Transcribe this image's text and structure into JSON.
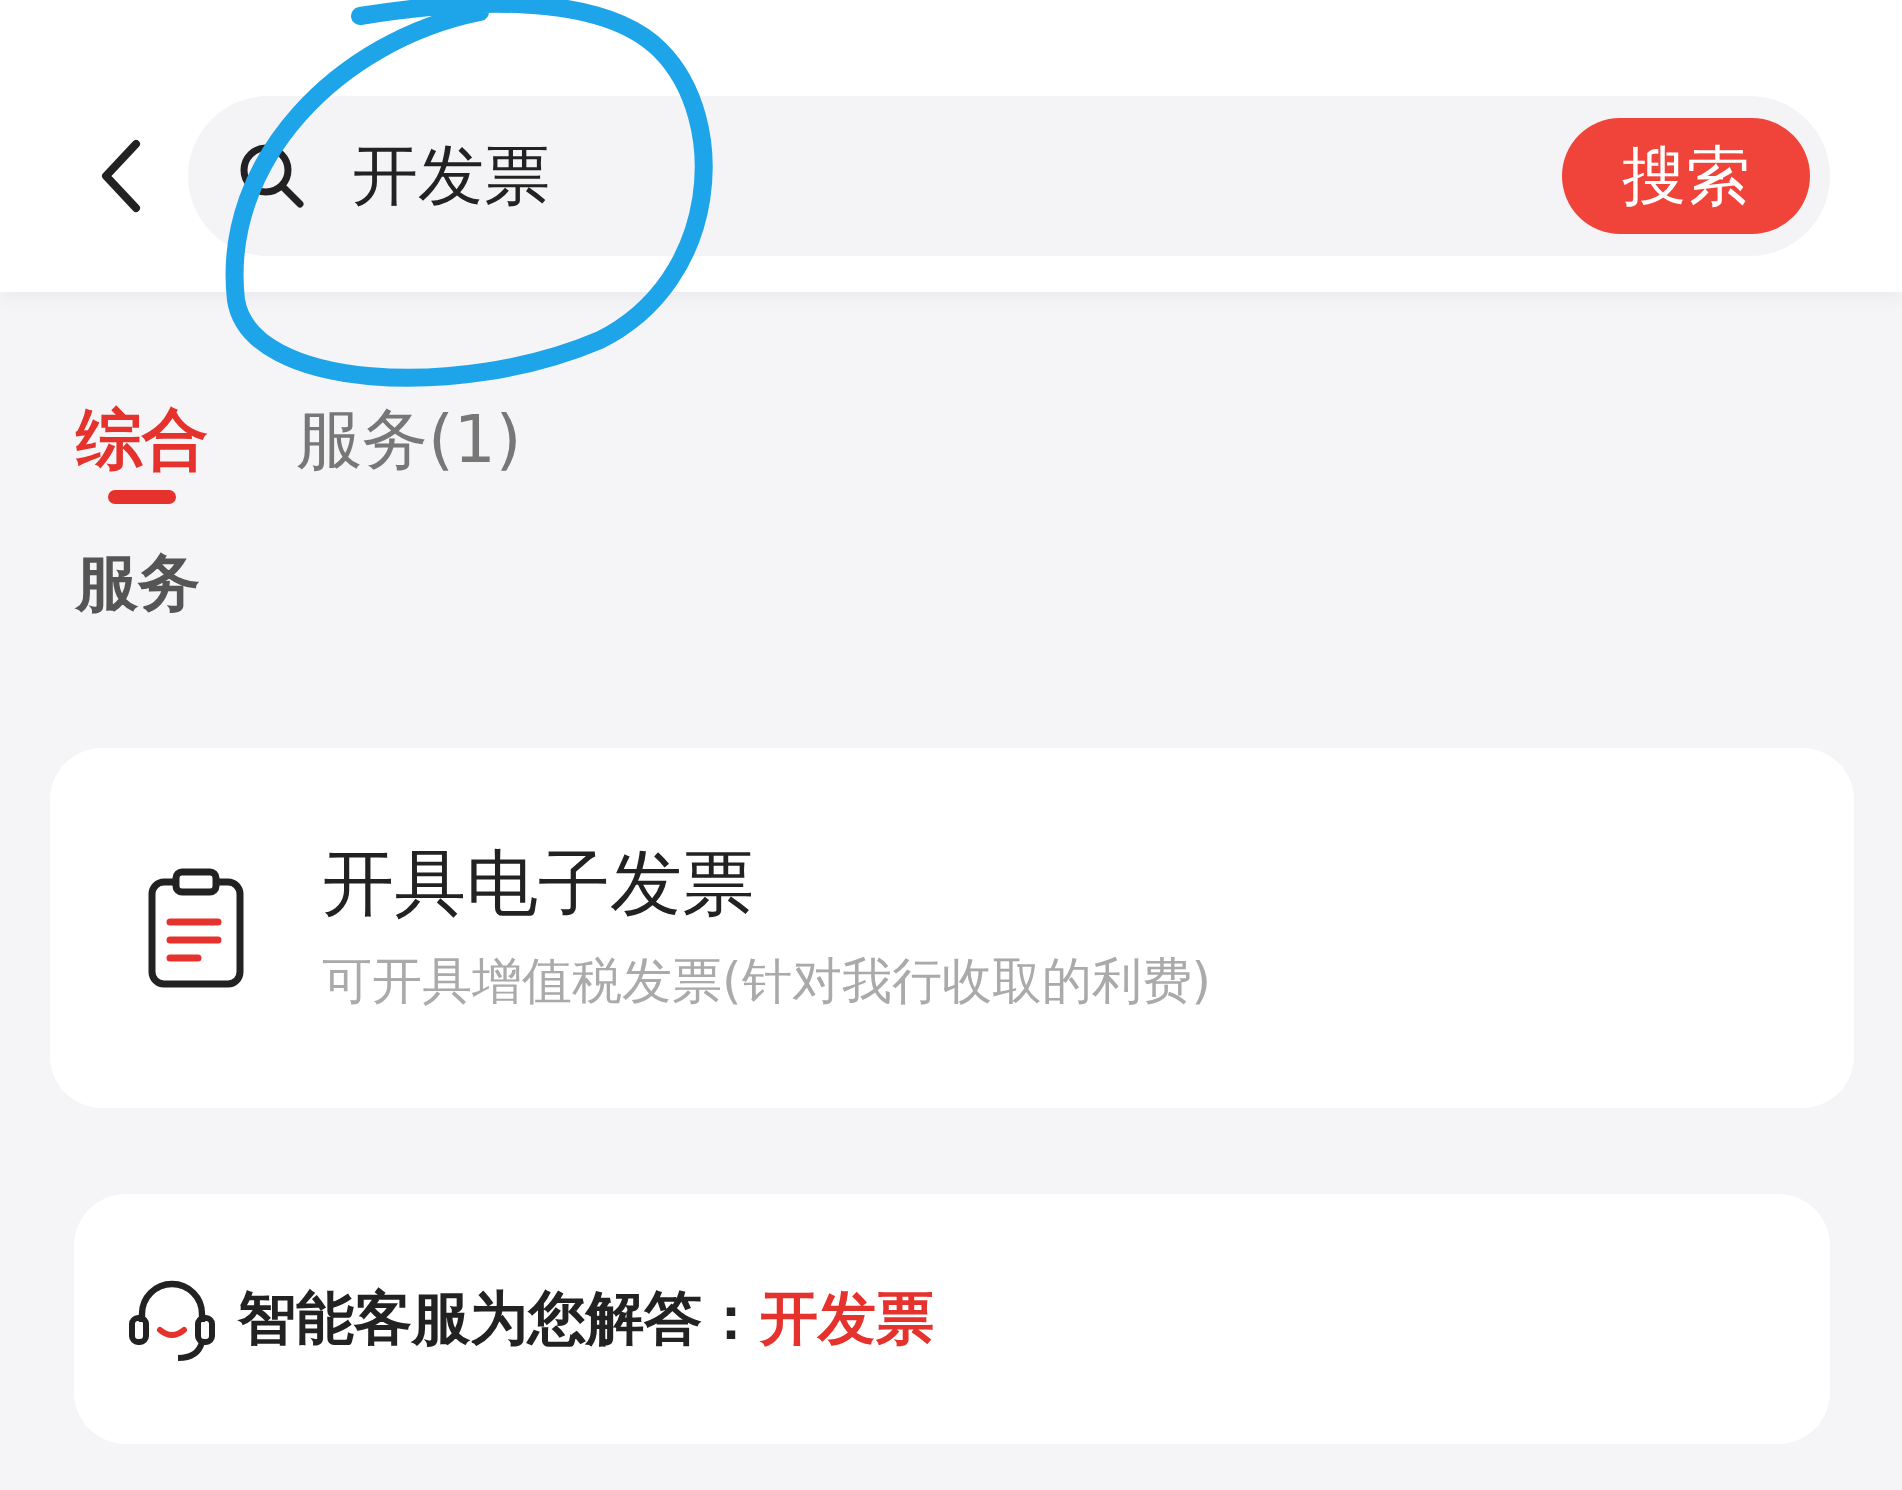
{
  "header": {
    "search": {
      "value": "开发票"
    },
    "search_button": "搜索"
  },
  "tabs": [
    {
      "label": "综合",
      "selected": true
    },
    {
      "label": "服务(1)",
      "selected": false
    }
  ],
  "section_title": "服务",
  "services": [
    {
      "title": "开具电子发票",
      "subtitle": "可开具增值税发票(针对我行收取的利费)"
    }
  ],
  "assistant": {
    "prompt": "智能客服为您解答：",
    "keyword": "开发票"
  }
}
